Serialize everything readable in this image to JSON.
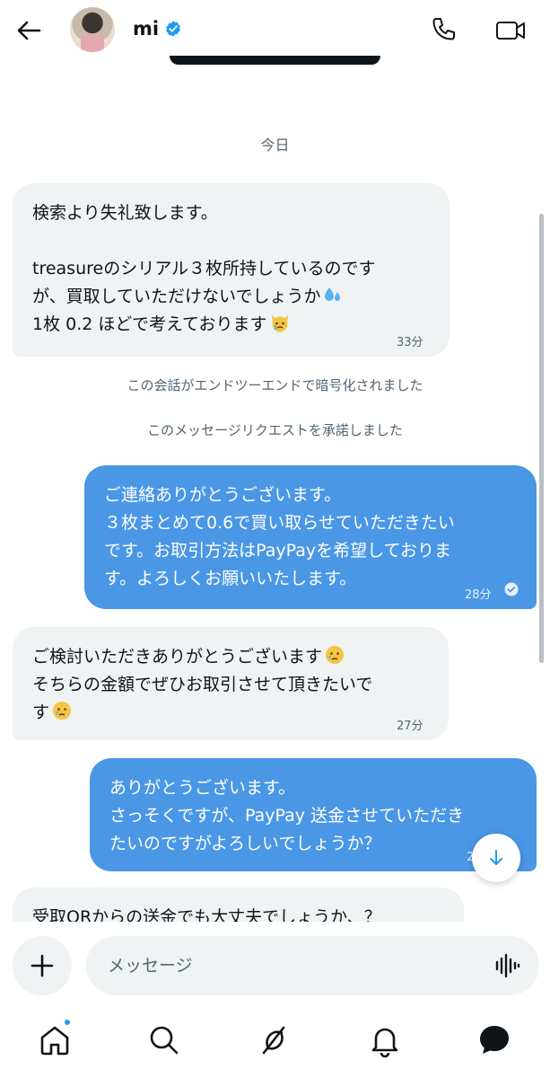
{
  "header": {
    "name": "mi"
  },
  "conversation": {
    "date_label": "今日",
    "messages": [
      {
        "lines": [
          "検索より失礼致します。",
          "",
          "treasureのシリアル３枚所持しているのです",
          "が、買取していただけないでしょうか",
          "1枚 0.2 ほどで考えております"
        ],
        "time": "33分"
      },
      {
        "lines": [
          "ご連絡ありがとうございます。",
          "３枚まとめて0.6で買い取らせていただきたい",
          "です。お取引方法はPayPayを希望しておりま",
          "す。よろしくお願いいたします。"
        ],
        "time": "28分"
      },
      {
        "lines": [
          "ご検討いただきありがとうございます",
          "そちらの金額でぜひお取引させて頂きたいで",
          "す"
        ],
        "time": "27分"
      },
      {
        "lines": [
          "ありがとうございます。",
          "さっそくですが、PayPay 送金させていただき",
          "たいのですがよろしいでしょうか？"
        ],
        "time": "2"
      },
      {
        "lines": [
          "受取QRからの送金でも大丈夫でしょうか、？"
        ]
      }
    ],
    "system": {
      "encrypted": "この会話がエンドツーエンドで暗号化されました",
      "accepted": "このメッセージリクエストを承諾しました"
    }
  },
  "composer": {
    "placeholder": "メッセージ"
  },
  "icons": {
    "back": "arrow-left-icon",
    "verified": "verified-badge-icon",
    "call": "phone-icon",
    "video": "video-camera-icon",
    "read": "read-check-icon",
    "scroll_down": "arrow-down-icon",
    "add": "plus-icon",
    "voice": "voice-wave-icon",
    "nav": [
      "home-icon",
      "search-icon",
      "grok-icon",
      "bell-icon",
      "messages-icon"
    ]
  },
  "colors": {
    "outgoing_bubble": "#4a97e5",
    "incoming_bubble": "#eff3f4",
    "accent": "#1d9bf0"
  }
}
